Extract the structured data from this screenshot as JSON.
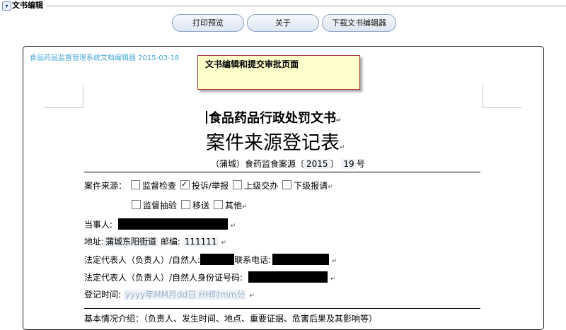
{
  "panel": {
    "title": "文书编辑"
  },
  "toolbar": {
    "print_preview": "打印预览",
    "about": "关于",
    "download_editor": "下载文书编辑器"
  },
  "editor": {
    "meta": "食品药品监督管理系统文档编辑器 2015-03-18",
    "tooltip": "文书编辑和提交审批页面"
  },
  "document": {
    "title1": "食品药品行政处罚文书",
    "title2": "案件来源登记表",
    "docno": {
      "prefix": "（蒲城）食药监食案源〔",
      "year": "2015",
      "suffix": "〕",
      "number": "19",
      "unit": "号"
    },
    "source_label": "案件来源：",
    "sources": [
      {
        "label": "监督检查",
        "checked": false
      },
      {
        "label": "投诉/举报",
        "checked": true
      },
      {
        "label": "上级交办",
        "checked": false
      },
      {
        "label": "下级报请",
        "checked": false
      },
      {
        "label": "监督抽验",
        "checked": false
      },
      {
        "label": "移送",
        "checked": false
      },
      {
        "label": "其他",
        "checked": false
      }
    ],
    "party_label": "当事人:",
    "address_label": "地址:",
    "address_value": "蒲城东阳街道",
    "postcode_label": "邮编:",
    "postcode_value": "111111",
    "legal_rep_label": "法定代表人（负责人）/自然人:",
    "phone_label": "联系电话:",
    "id_label": "法定代表人（负责人）/自然人身份证号码:",
    "reg_time_label": "登记时间:",
    "reg_time_placeholder": "yyyy年MM月dd日 HH时mm分",
    "basic_info_label": "基本情况介绍：（负责人、发生时间、地点、重要证据、危害后果及其影响等）",
    "para_mark": "↵"
  }
}
